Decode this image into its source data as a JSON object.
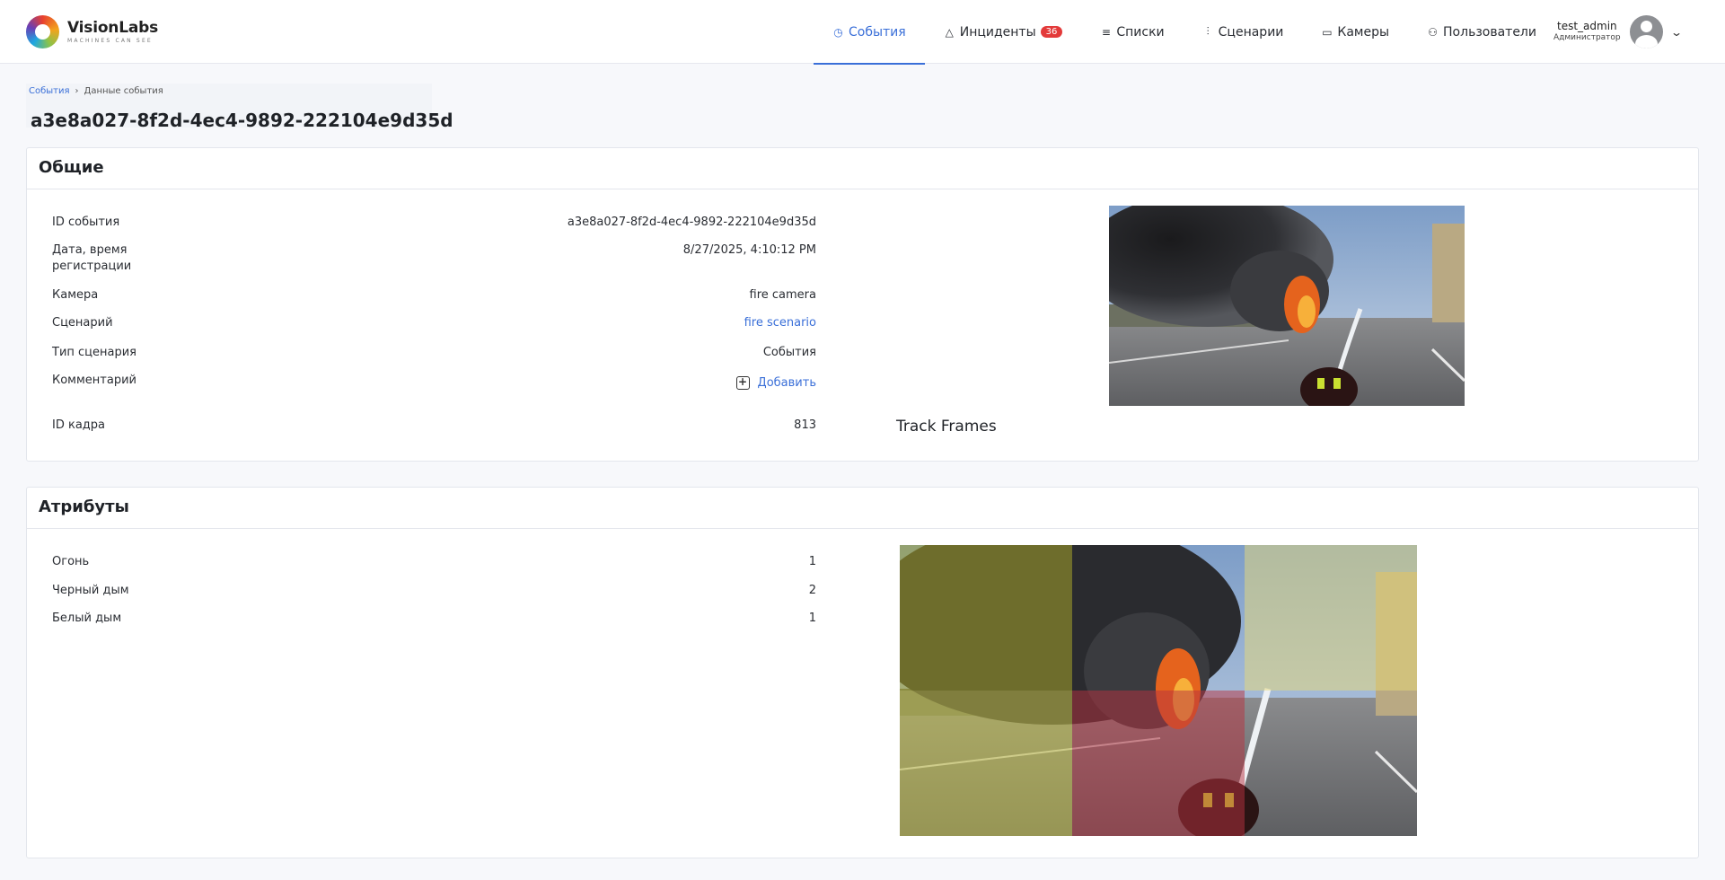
{
  "app": {
    "logo_name": "VisionLabs",
    "logo_tagline": "MACHINES CAN SEE"
  },
  "nav": {
    "items": [
      {
        "label": "События",
        "icon": "clock-icon",
        "active": true
      },
      {
        "label": "Инциденты",
        "icon": "warning-icon",
        "badge": "36"
      },
      {
        "label": "Списки",
        "icon": "list-icon"
      },
      {
        "label": "Сценарии",
        "icon": "sliders-icon"
      },
      {
        "label": "Камеры",
        "icon": "video-icon"
      },
      {
        "label": "Пользователи",
        "icon": "users-icon"
      }
    ]
  },
  "user": {
    "name": "test_admin",
    "role": "Администратор"
  },
  "breadcrumb": {
    "root": "События",
    "current": "Данные события"
  },
  "page": {
    "title": "a3e8a027-8f2d-4ec4-9892-222104e9d35d"
  },
  "general": {
    "title": "Общие",
    "event_id_label": "ID события",
    "event_id": "a3e8a027-8f2d-4ec4-9892-222104e9d35d",
    "datetime_label": "Дата, время регистрации",
    "datetime": "8/27/2025, 4:10:12 PM",
    "camera_label": "Камера",
    "camera": "fire camera",
    "scenario_label": "Сценарий",
    "scenario": "fire scenario",
    "scenario_type_label": "Тип сценария",
    "scenario_type": "События",
    "comment_label": "Комментарий",
    "comment_add": "Добавить",
    "frame_id_label": "ID кадра",
    "frame_id": "813",
    "track_frames": "Track Frames"
  },
  "attributes": {
    "title": "Атрибуты",
    "items": [
      {
        "label": "Огонь",
        "value": "1"
      },
      {
        "label": "Черный дым",
        "value": "2"
      },
      {
        "label": "Белый дым",
        "value": "1"
      }
    ]
  }
}
